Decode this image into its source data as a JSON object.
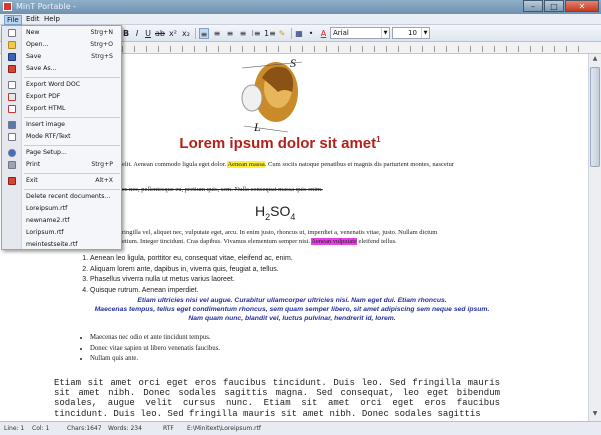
{
  "window": {
    "title": "MinT Portable -"
  },
  "menubar": {
    "file": "File",
    "edit": "Edit",
    "help": "Help"
  },
  "toolbar": {
    "font": "Arial",
    "size": "10"
  },
  "file_menu": {
    "new": {
      "label": "New",
      "shortcut": "Strg+N"
    },
    "open": {
      "label": "Open...",
      "shortcut": "Strg+O"
    },
    "save": {
      "label": "Save",
      "shortcut": "Strg+S"
    },
    "save_as": {
      "label": "Save As..."
    },
    "export_doc": {
      "label": "Export Word DOC"
    },
    "export_pdf": {
      "label": "Export PDF"
    },
    "export_html": {
      "label": "Export HTML"
    },
    "insert_image": {
      "label": "Insert image"
    },
    "mode_rtf": {
      "label": "Mode RTF/Text"
    },
    "page_setup": {
      "label": "Page Setup..."
    },
    "print": {
      "label": "Print",
      "shortcut": "Strg+P"
    },
    "exit": {
      "label": "Exit",
      "shortcut": "Alt+X"
    },
    "delete_recent": {
      "label": "Delete recent documents..."
    },
    "recent": [
      "Loreipsum.rtf",
      "newname2.rtf",
      "Loripsum.rtf",
      "meintestseite.rtf"
    ]
  },
  "document": {
    "title": "Lorem ipsum dolor sit amet",
    "title_sup": "1",
    "logo_letters": {
      "s": "S",
      "l": "L"
    },
    "p1_pre": "elit. Aenean commodo ligula eget dolor.",
    "p1_hl": "Aenean massa",
    "p1_post": ". Cum sociis natoque penatibus et magnis dis parturient montes, nascetur",
    "p2_strike": "es nec, pellentesque eu, pretium quis, sem. Nulla consequat massa quis enim.",
    "h2so4_main": "H",
    "h2so4_sub1": "2",
    "h2so4_mid": "SO",
    "h2so4_sub2": "4",
    "p3_line1": "ringilla vel, aliquet nec, vulputate eget, arcu. In enim justo, rhoncus ut, imperdiet a, venenatis vitae, justo. Nullam dictum",
    "p3_line2_pre": "etium. Integer tincidunt. Cras dapibus. Vivamus elementum semper nisi.",
    "p3_line2_hl": "Aenean vulputate",
    "p3_line2_post": "eleifend tellus.",
    "ordered_list": [
      "Aenean leo ligula, porttitor eu, consequat vitae, eleifend ac, enim.",
      "Aliquam lorem ante, dapibus in, viverra quis, feugiat a, tellus.",
      "Phasellus viverra nulla ut metus varius laoreet.",
      "Quisque rutrum. Aenean imperdiet."
    ],
    "blue_lines": [
      "Etiam ultricies nisi vel augue. Curabitur ullamcorper ultricies nisi. Nam eget dui. Etiam rhoncus.",
      "Maecenas tempus, tellus eget condimentum rhoncus, sem quam semper libero, sit amet adipiscing sem neque sed ipsum.",
      "Nam quam nunc, blandit vel, luctus pulvinar, hendrerit id, lorem."
    ],
    "bullet_list": [
      "Maecenas nec odio et ante tincidunt tempus.",
      "Donec vitae sapien ut libero venenatis faucibus.",
      "Nullam quis ante."
    ],
    "mono_text": "Etiam sit amet orci eget eros faucibus tincidunt. Duis leo. Sed fringilla mauris sit amet nibh. Donec sodales sagittis magna. Sed consequat, leo eget bibendum sodales, augue velit cursus nunc. Etiam sit amet orci eget eros faucibus tincidunt. Duis leo. Sed fringilla mauris sit amet nibh. Donec sodales sagittis"
  },
  "status": {
    "line": "Line: 1",
    "col": "Col: 1",
    "chars": "Chars:1647",
    "words": "Words: 234",
    "mode": "RTF",
    "path": "E:\\Minitext\\Loreipsum.rtf"
  }
}
